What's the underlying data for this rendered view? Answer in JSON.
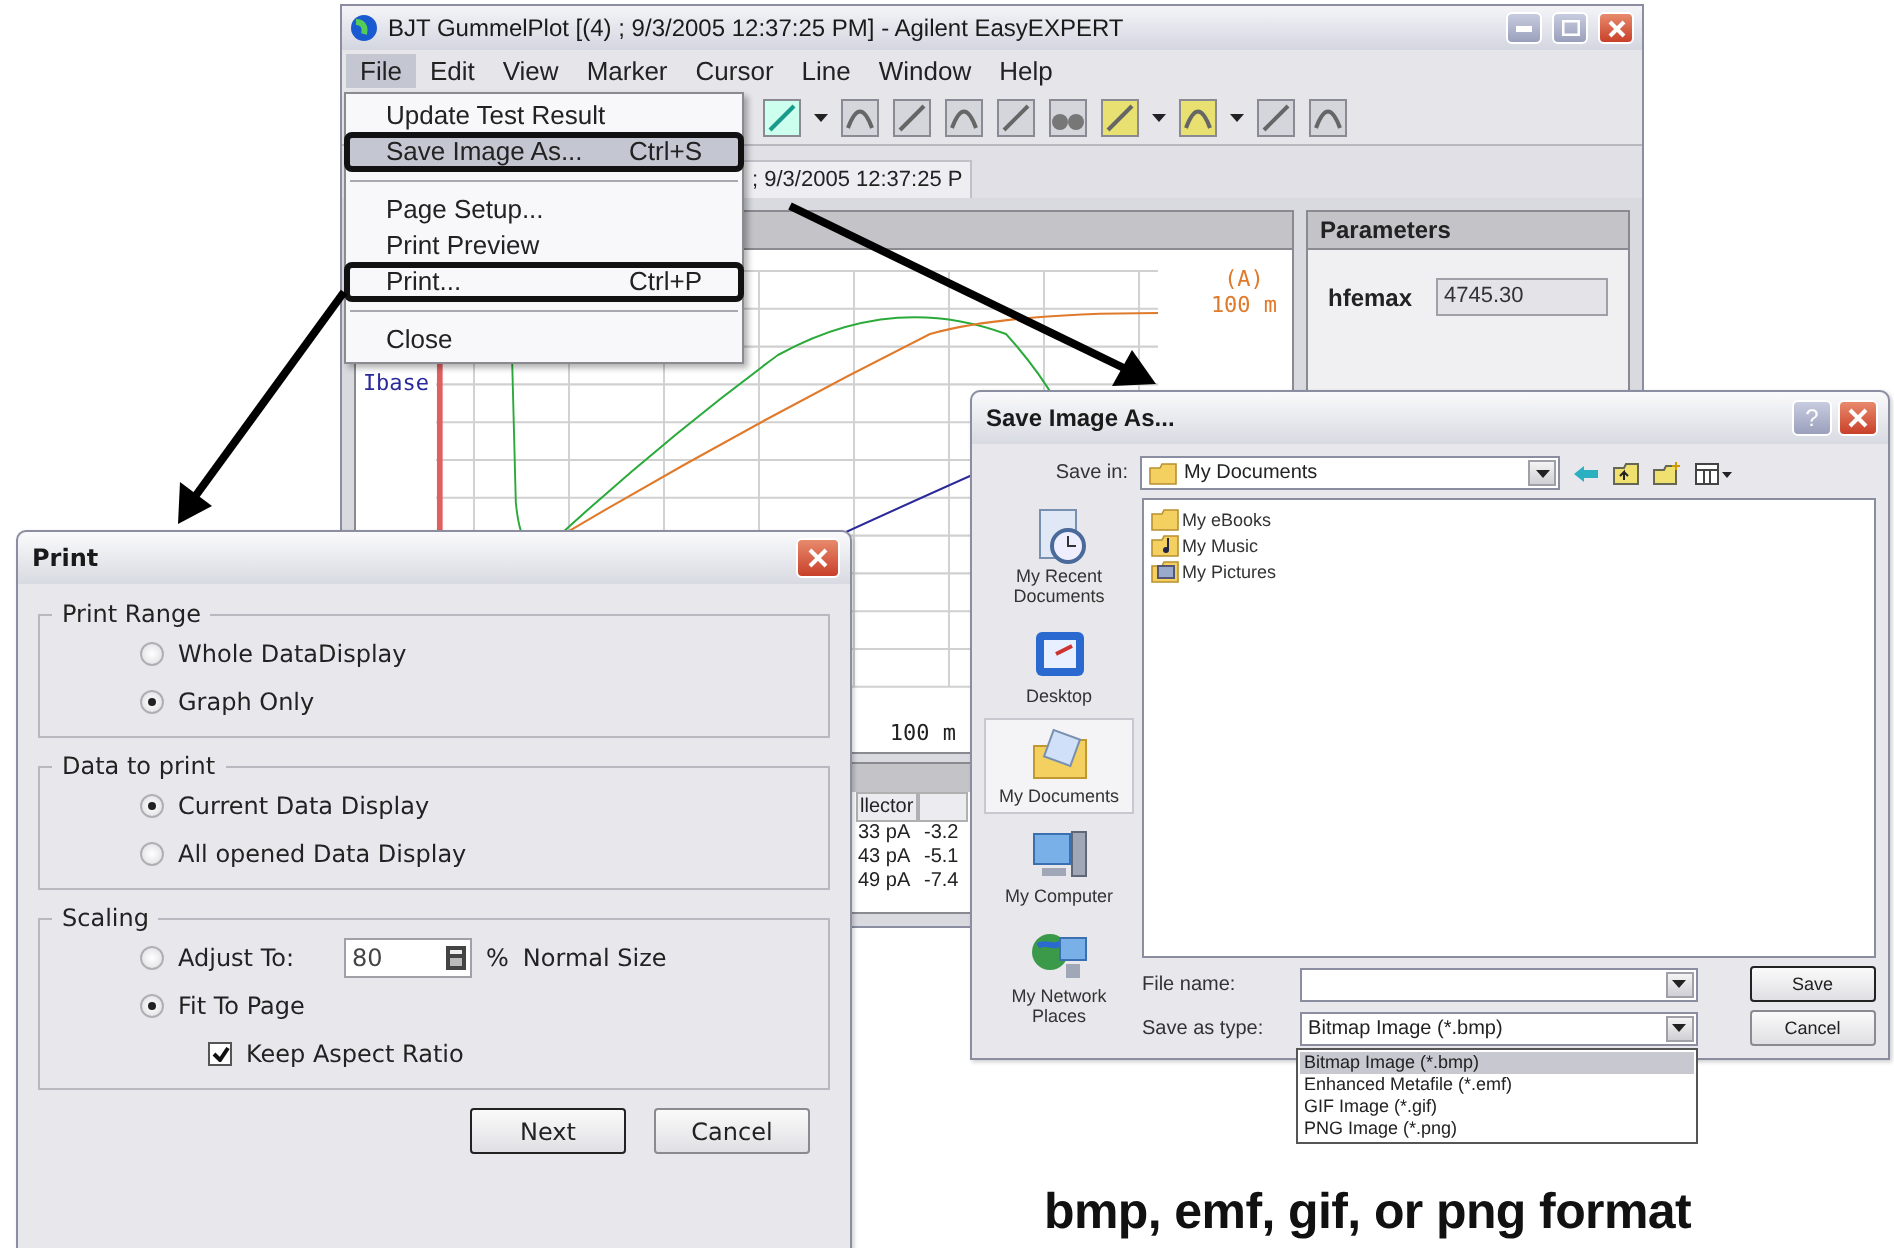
{
  "main_window": {
    "title": "BJT GummelPlot [(4) ; 9/3/2005 12:37:25 PM] - Agilent EasyEXPERT",
    "menu": [
      {
        "label": "File",
        "selected": true
      },
      {
        "label": "Edit",
        "selected": false
      },
      {
        "label": "View",
        "selected": false
      },
      {
        "label": "Marker",
        "selected": false
      },
      {
        "label": "Cursor",
        "selected": false
      },
      {
        "label": "Line",
        "selected": false
      },
      {
        "label": "Window",
        "selected": false
      },
      {
        "label": "Help",
        "selected": false
      }
    ],
    "tab": "; 9/3/2005 12:37:25 P",
    "graph": {
      "y2_unit": "(A)",
      "y2_top": "100 m",
      "y_label": "Ibase",
      "x_value": "100 m"
    },
    "parameters": {
      "title": "Parameters",
      "name": "hfemax",
      "value": "4745.30"
    },
    "table": {
      "columns": [
        "llector"
      ],
      "rows": [
        [
          "33 pA",
          "-3.2"
        ],
        [
          "43 pA",
          "-5.1"
        ],
        [
          "49 pA",
          "-7.4"
        ]
      ]
    }
  },
  "file_menu": [
    {
      "kind": "item",
      "label": "Update Test Result",
      "highlighted": false,
      "callout": false
    },
    {
      "kind": "item",
      "label": "Save Image As...",
      "shortcut": "Ctrl+S",
      "highlighted": true,
      "callout": true
    },
    {
      "kind": "separator"
    },
    {
      "kind": "item",
      "label": "Page Setup...",
      "highlighted": false,
      "callout": false
    },
    {
      "kind": "item",
      "label": "Print Preview",
      "highlighted": false,
      "callout": false
    },
    {
      "kind": "item",
      "label": "Print...",
      "shortcut": "Ctrl+P",
      "highlighted": false,
      "callout": true
    },
    {
      "kind": "separator"
    },
    {
      "kind": "item",
      "label": "Close",
      "highlighted": false,
      "callout": false
    }
  ],
  "print_dialog": {
    "title": "Print",
    "groups": [
      {
        "title": "Print Range",
        "options": [
          {
            "label": "Whole DataDisplay",
            "selected": false
          },
          {
            "label": "Graph Only",
            "selected": true
          }
        ]
      },
      {
        "title": "Data to print",
        "options": [
          {
            "label": "Current Data Display",
            "selected": true
          },
          {
            "label": "All opened Data Display",
            "selected": false
          }
        ]
      }
    ],
    "scaling": {
      "title": "Scaling",
      "adjust": {
        "label": "Adjust To:",
        "selected": false,
        "value": "80",
        "unit": "%",
        "suffix": "Normal Size"
      },
      "fit": {
        "label": "Fit To Page",
        "selected": true
      },
      "keep_aspect": {
        "label": "Keep Aspect Ratio",
        "checked": true
      }
    },
    "buttons": [
      "Next",
      "Cancel"
    ]
  },
  "save_dialog": {
    "title": "Save Image As...",
    "help": "?",
    "save_in_label": "Save in:",
    "save_in": "My Documents",
    "places": [
      {
        "label": "My Recent Documents",
        "kind": "recent",
        "selected": false
      },
      {
        "label": "Desktop",
        "kind": "desktop",
        "selected": false
      },
      {
        "label": "My Documents",
        "kind": "documents",
        "selected": true
      },
      {
        "label": "My Computer",
        "kind": "computer",
        "selected": false
      },
      {
        "label": "My Network Places",
        "kind": "network",
        "selected": false
      }
    ],
    "files": [
      {
        "name": "My eBooks",
        "kind": "folder"
      },
      {
        "name": "My Music",
        "kind": "music"
      },
      {
        "name": "My Pictures",
        "kind": "pictures"
      }
    ],
    "file_name_label": "File name:",
    "type_label": "Save as type:",
    "type_value": "Bitmap Image (*.bmp)",
    "type_options": [
      {
        "label": "Bitmap Image (*.bmp)",
        "selected": true
      },
      {
        "label": "Enhanced Metafile (*.emf)",
        "selected": false
      },
      {
        "label": "GIF Image (*.gif)",
        "selected": false
      },
      {
        "label": "PNG Image (*.png)",
        "selected": false
      }
    ],
    "buttons": [
      "Save",
      "Cancel"
    ]
  },
  "caption": "bmp, emf, gif, or png format"
}
